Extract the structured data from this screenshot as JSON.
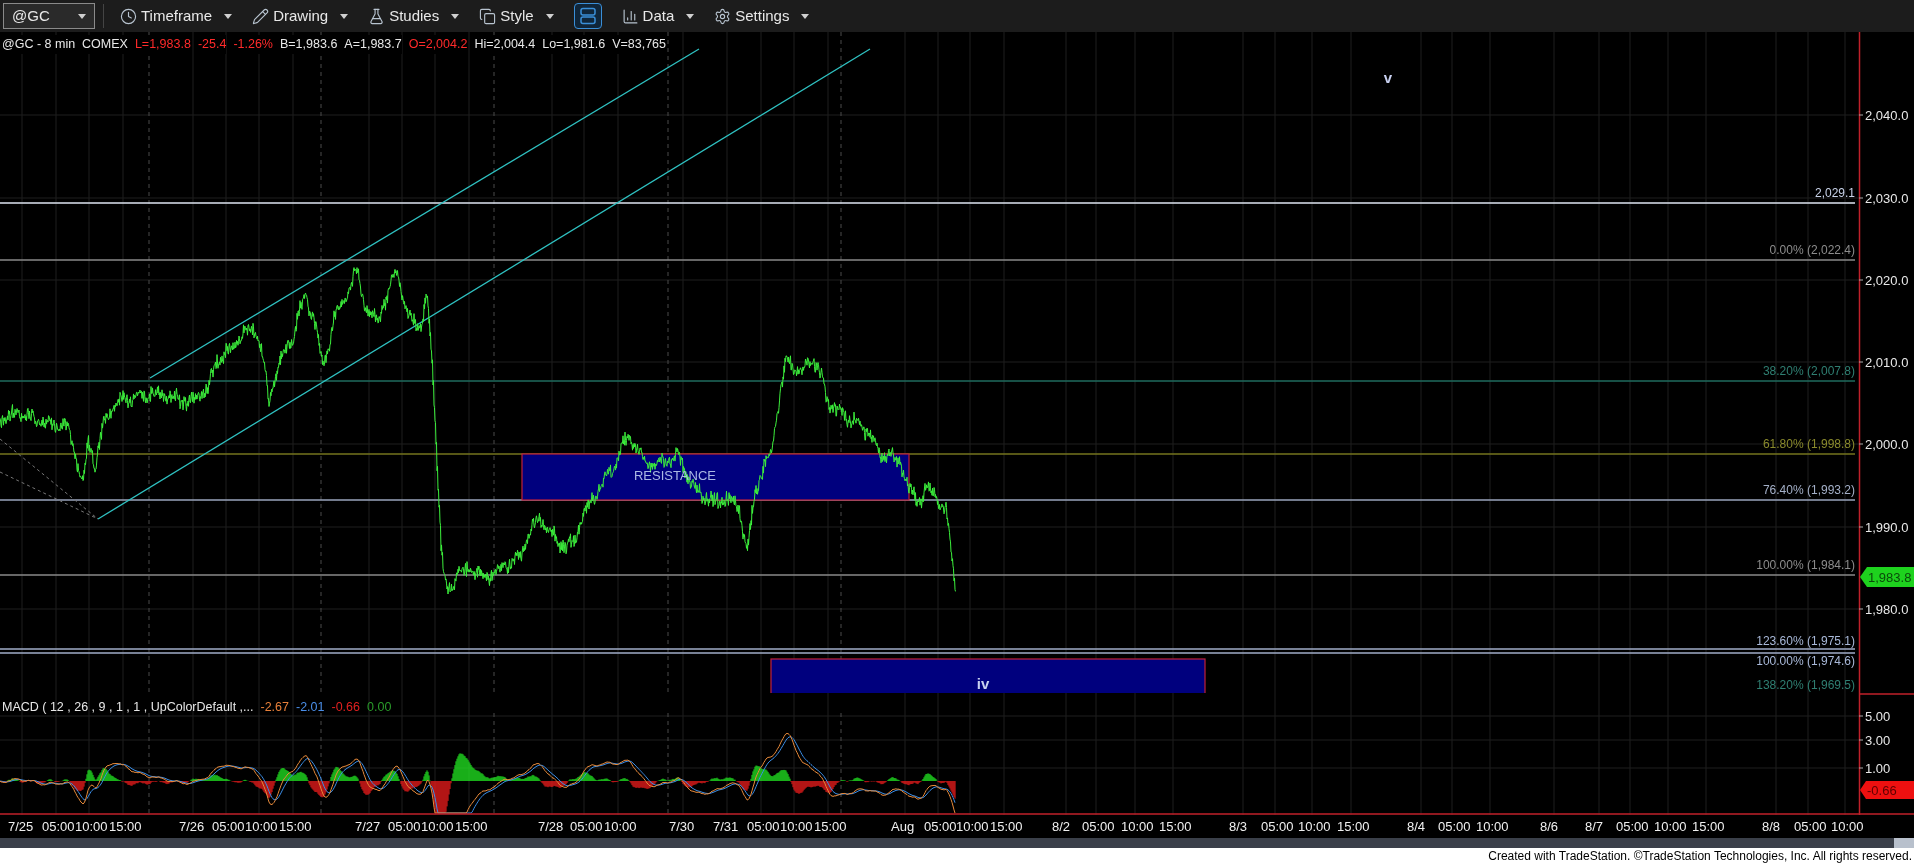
{
  "toolbar": {
    "symbol": "@GC",
    "items": [
      {
        "kind": "timeframe",
        "label": "Timeframe"
      },
      {
        "kind": "drawing",
        "label": "Drawing"
      },
      {
        "kind": "studies",
        "label": "Studies"
      },
      {
        "kind": "style",
        "label": "Style"
      },
      {
        "kind": "layout",
        "selected": true
      },
      {
        "kind": "data",
        "label": "Data"
      },
      {
        "kind": "settings",
        "label": "Settings"
      }
    ]
  },
  "quote_line": [
    {
      "text": "@GC - 8 min  COMEX",
      "color": "#e8e8e8"
    },
    {
      "text": "L=1,983.8",
      "color": "#ff2a2a"
    },
    {
      "text": "-25.4",
      "color": "#ff2a2a"
    },
    {
      "text": "-1.26%",
      "color": "#ff2a2a"
    },
    {
      "text": "B=1,983.6",
      "color": "#e8e8e8"
    },
    {
      "text": "A=1,983.7",
      "color": "#e8e8e8"
    },
    {
      "text": "O=2,004.2",
      "color": "#ff2a2a"
    },
    {
      "text": "Hi=2,004.4",
      "color": "#e8e8e8"
    },
    {
      "text": "Lo=1,981.6",
      "color": "#e8e8e8"
    },
    {
      "text": "V=83,765",
      "color": "#e8e8e8"
    }
  ],
  "chart": {
    "price_axis": [
      "2,040.0",
      "2,030.0",
      "2,020.0",
      "2,010.0",
      "2,000.0",
      "1,990.0",
      "1,980.0"
    ],
    "levels": [
      {
        "label": "2,029.1",
        "color": "#c8d2e8"
      },
      {
        "label": "0.00% (2,022.4)",
        "color": "#8c8c8c"
      },
      {
        "label": "38.20% (2,007.8)",
        "color": "#2f7f72"
      },
      {
        "label": "61.80% (1,998.8)",
        "color": "#8a8a2c"
      },
      {
        "label": "76.40% (1,993.2)",
        "color": "#a4b0c8"
      },
      {
        "label": "100.00% (1,984.1)",
        "color": "#8c8c8c"
      },
      {
        "label": "123.60% (1,975.1)",
        "color": "#a8b8d8"
      },
      {
        "label": "100.00% (1,974.6)",
        "color": "#a8b8d8"
      },
      {
        "label": "138.20% (1,969.5)",
        "color": "#2f7f72"
      }
    ],
    "zones": [
      {
        "label": "RESISTANCE"
      },
      {
        "label": "iv"
      }
    ],
    "wave_label": "v",
    "last_price": "1,983.8"
  },
  "macd": {
    "title": "MACD ( 12 , 26 , 9 , 1 , 1 , UpColorDefault ,...",
    "values": [
      {
        "text": "-2.67",
        "color": "#e8803a"
      },
      {
        "text": "-2.01",
        "color": "#4a8ee8"
      },
      {
        "text": "-0.66",
        "color": "#e02020"
      },
      {
        "text": "0.00",
        "color": "#2a9a2a"
      }
    ],
    "axis": [
      "5.00",
      "3.00",
      "1.00"
    ],
    "last_value": "-0.66"
  },
  "time_axis": [
    "7/25",
    "05:00",
    "10:00",
    "15:00",
    "7/26",
    "05:00",
    "10:00",
    "15:00",
    "7/27",
    "05:00",
    "10:00",
    "15:00",
    "7/28",
    "05:00",
    "10:00",
    "7/30",
    "7/31",
    "05:00",
    "10:00",
    "15:00",
    "Aug",
    "05:00",
    "10:00",
    "15:00",
    "8/2",
    "05:00",
    "10:00",
    "15:00",
    "8/3",
    "05:00",
    "10:00",
    "15:00",
    "8/4",
    "05:00",
    "10:00",
    "8/6",
    "8/7",
    "05:00",
    "10:00",
    "15:00",
    "8/8",
    "05:00",
    "10:00"
  ],
  "footer": "Created with TradeStation. ©TradeStation Technologies, Inc. All rights reserved."
}
